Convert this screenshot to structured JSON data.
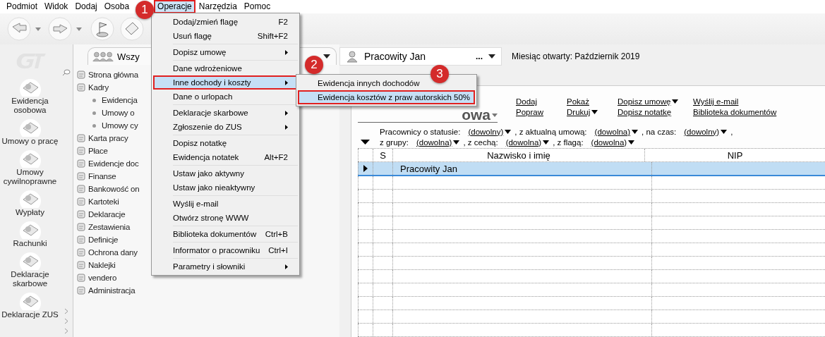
{
  "menubar": [
    {
      "label": "Podmiot",
      "selected": false
    },
    {
      "label": "Widok",
      "selected": false
    },
    {
      "label": "Dodaj",
      "selected": false
    },
    {
      "label": "Osoba",
      "selected": false
    },
    {
      "label": "Operacje",
      "selected": true
    },
    {
      "label": "Narzędzia",
      "selected": false
    },
    {
      "label": "Pomoc",
      "selected": false
    }
  ],
  "sidebar": {
    "items": [
      {
        "label": "Ewidencja osobowa"
      },
      {
        "label": "Umowy o pracę"
      },
      {
        "label": "Umowy cywilnoprawne"
      },
      {
        "label": "Wypłaty"
      },
      {
        "label": "Rachunki"
      },
      {
        "label": "Deklaracje skarbowe"
      },
      {
        "label": "Deklaracje ZUS"
      }
    ]
  },
  "tree": {
    "header": "Wszy",
    "items": [
      {
        "label": "Strona główna"
      },
      {
        "label": "Kadry",
        "children": [
          {
            "label": "Ewidencja"
          },
          {
            "label": "Umowy o"
          },
          {
            "label": "Umowy cy"
          }
        ]
      },
      {
        "label": "Karta pracy"
      },
      {
        "label": "Płace"
      },
      {
        "label": "Ewidencje doc"
      },
      {
        "label": "Finanse"
      },
      {
        "label": "Bankowość on"
      },
      {
        "label": "Kartoteki"
      },
      {
        "label": "Deklaracje"
      },
      {
        "label": "Zestawienia"
      },
      {
        "label": "Definicje"
      },
      {
        "label": "Ochrona dany"
      },
      {
        "label": "Naklejki"
      },
      {
        "label": "vendero"
      },
      {
        "label": "Administracja"
      }
    ]
  },
  "person_selector": {
    "value": "Pracowity Jan",
    "more": "..."
  },
  "month": {
    "label": "Miesiąc otwarty:",
    "value": "Październik 2019"
  },
  "heading": "owa",
  "actions": [
    [
      {
        "label": "Dodaj",
        "dropdown": false
      },
      {
        "label": "Popraw",
        "dropdown": false
      }
    ],
    [
      {
        "label": "Pokaż",
        "dropdown": false
      },
      {
        "label": "Drukuj",
        "dropdown": true
      }
    ],
    [
      {
        "label": "Dopisz umowę",
        "dropdown": true
      },
      {
        "label": "Dopisz notatkę",
        "dropdown": false
      }
    ],
    [
      {
        "label": "Wyślij e-mail",
        "dropdown": false
      },
      {
        "label": "Biblioteka dokumentów",
        "dropdown": false
      }
    ]
  ],
  "filters": [
    [
      {
        "kind": "label",
        "text": "Pracownicy o statusie:"
      },
      {
        "kind": "choice",
        "text": "(dowolny)"
      },
      {
        "kind": "label",
        "text": ", z aktualną umową:"
      },
      {
        "kind": "choice",
        "text": "(dowolna)"
      },
      {
        "kind": "label",
        "text": ", na czas:"
      },
      {
        "kind": "choice",
        "text": "(dowolny)"
      },
      {
        "kind": "label",
        "text": ","
      }
    ],
    [
      {
        "kind": "label",
        "text": "z grupy:"
      },
      {
        "kind": "choice",
        "text": "(dowolna)"
      },
      {
        "kind": "label",
        "text": ", z cechą:"
      },
      {
        "kind": "choice",
        "text": "(dowolna)"
      },
      {
        "kind": "label",
        "text": ", z flagą:"
      },
      {
        "kind": "choice",
        "text": "(dowolna)"
      }
    ]
  ],
  "table": {
    "columns": [
      {
        "label": "S"
      },
      {
        "label": "Nazwisko i imię"
      },
      {
        "label": "NIP"
      }
    ],
    "rows": [
      {
        "name": "Pracowity Jan",
        "selected": true
      }
    ]
  },
  "context_menu": {
    "groups": [
      [
        {
          "label": "Dodaj/zmień flagę",
          "shortcut": "F2",
          "submenu": false,
          "selected": false
        },
        {
          "label": "Usuń flagę",
          "shortcut": "Shift+F2",
          "submenu": false,
          "selected": false
        }
      ],
      [
        {
          "label": "Dopisz umowę",
          "submenu": true,
          "selected": false
        }
      ],
      [
        {
          "label": "Dane wdrożeniowe",
          "submenu": false,
          "selected": false
        },
        {
          "label": "Inne dochody i koszty",
          "submenu": true,
          "selected": true
        },
        {
          "label": "Dane o urlopach",
          "submenu": false,
          "selected": false
        }
      ],
      [
        {
          "label": "Deklaracje skarbowe",
          "submenu": true,
          "selected": false
        },
        {
          "label": "Zgłoszenie do ZUS",
          "submenu": true,
          "selected": false
        }
      ],
      [
        {
          "label": "Dopisz notatkę",
          "submenu": false,
          "selected": false
        },
        {
          "label": "Ewidencja notatek",
          "shortcut": "Alt+F2",
          "submenu": false,
          "selected": false
        }
      ],
      [
        {
          "label": "Ustaw jako aktywny",
          "submenu": false,
          "selected": false
        },
        {
          "label": "Ustaw jako nieaktywny",
          "submenu": false,
          "selected": false
        }
      ],
      [
        {
          "label": "Wyślij e-mail",
          "submenu": false,
          "selected": false
        },
        {
          "label": "Otwórz stronę WWW",
          "submenu": false,
          "selected": false
        }
      ],
      [
        {
          "label": "Biblioteka dokumentów",
          "shortcut": "Ctrl+B",
          "submenu": false,
          "selected": false
        }
      ],
      [
        {
          "label": "Informator o pracowniku",
          "shortcut": "Ctrl+I",
          "submenu": false,
          "selected": false
        }
      ],
      [
        {
          "label": "Parametry i słowniki",
          "submenu": true,
          "selected": false
        }
      ]
    ]
  },
  "submenu": {
    "items": [
      {
        "label": "Ewidencja innych dochodów",
        "selected": false
      },
      {
        "label": "Ewidencja kosztów z praw autorskich 50%",
        "selected": true
      }
    ]
  },
  "callouts": [
    "1",
    "2",
    "3"
  ]
}
